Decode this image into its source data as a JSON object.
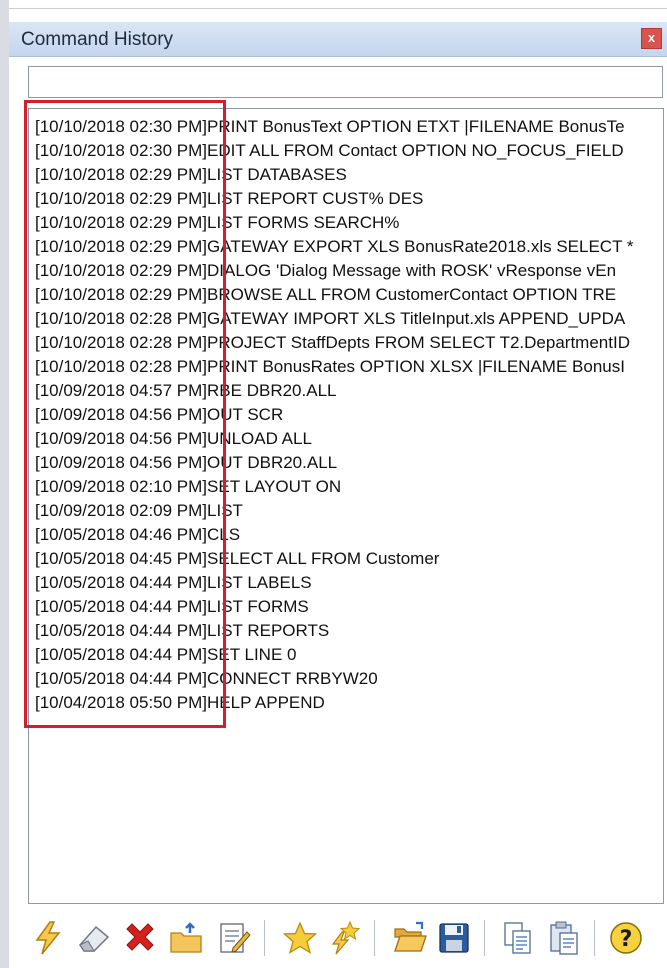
{
  "window": {
    "title": "Command History",
    "close_label": "x"
  },
  "command_input": {
    "value": "",
    "placeholder": ""
  },
  "history": [
    {
      "timestamp": "[10/10/2018 02:30 PM]",
      "command": "PRINT BonusText OPTION ETXT |FILENAME BonusTe"
    },
    {
      "timestamp": "[10/10/2018 02:30 PM]",
      "command": "EDIT ALL FROM Contact OPTION NO_FOCUS_FIELD"
    },
    {
      "timestamp": "[10/10/2018 02:29 PM]",
      "command": "LIST DATABASES"
    },
    {
      "timestamp": "[10/10/2018 02:29 PM]",
      "command": "LIST REPORT CUST% DES"
    },
    {
      "timestamp": "[10/10/2018 02:29 PM]",
      "command": "LIST FORMS SEARCH%"
    },
    {
      "timestamp": "[10/10/2018 02:29 PM]",
      "command": "GATEWAY EXPORT XLS BonusRate2018.xls SELECT *"
    },
    {
      "timestamp": "[10/10/2018 02:29 PM]",
      "command": "DIALOG 'Dialog Message with ROSK' vResponse vEn"
    },
    {
      "timestamp": "[10/10/2018 02:29 PM]",
      "command": "BROWSE ALL FROM CustomerContact OPTION TRE"
    },
    {
      "timestamp": "[10/10/2018 02:28 PM]",
      "command": "GATEWAY IMPORT XLS TitleInput.xls APPEND_UPDA"
    },
    {
      "timestamp": "[10/10/2018 02:28 PM]",
      "command": "PROJECT StaffDepts FROM SELECT T2.DepartmentID"
    },
    {
      "timestamp": "[10/10/2018 02:28 PM]",
      "command": "PRINT BonusRates OPTION XLSX |FILENAME BonusI"
    },
    {
      "timestamp": "[10/09/2018 04:57 PM]",
      "command": "RBE DBR20.ALL"
    },
    {
      "timestamp": "[10/09/2018 04:56 PM]",
      "command": "OUT SCR"
    },
    {
      "timestamp": "[10/09/2018 04:56 PM]",
      "command": "UNLOAD ALL"
    },
    {
      "timestamp": "[10/09/2018 04:56 PM]",
      "command": "OUT DBR20.ALL"
    },
    {
      "timestamp": "[10/09/2018 02:10 PM]",
      "command": "SET LAYOUT ON"
    },
    {
      "timestamp": "[10/09/2018 02:09 PM]",
      "command": "LIST"
    },
    {
      "timestamp": "[10/05/2018 04:46 PM]",
      "command": "CLS"
    },
    {
      "timestamp": "[10/05/2018 04:45 PM]",
      "command": "SELECT ALL FROM Customer"
    },
    {
      "timestamp": "[10/05/2018 04:44 PM]",
      "command": "LIST LABELS"
    },
    {
      "timestamp": "[10/05/2018 04:44 PM]",
      "command": "LIST FORMS"
    },
    {
      "timestamp": "[10/05/2018 04:44 PM]",
      "command": "LIST REPORTS"
    },
    {
      "timestamp": "[10/05/2018 04:44 PM]",
      "command": "SET LINE 0"
    },
    {
      "timestamp": "[10/05/2018 04:44 PM]",
      "command": "CONNECT RRBYW20"
    },
    {
      "timestamp": "[10/04/2018 05:50 PM]",
      "command": "HELP APPEND"
    }
  ],
  "toolbar": [
    {
      "name": "execute-button",
      "icon": "lightning-icon"
    },
    {
      "name": "erase-button",
      "icon": "eraser-icon"
    },
    {
      "name": "delete-button",
      "icon": "red-x-icon"
    },
    {
      "name": "export-button",
      "icon": "folder-arrow-icon"
    },
    {
      "name": "edit-button",
      "icon": "edit-document-icon"
    },
    {
      "name": "favorite-button",
      "icon": "star-icon"
    },
    {
      "name": "add-favorite-button",
      "icon": "star-lightning-icon"
    },
    {
      "name": "open-button",
      "icon": "open-folder-icon"
    },
    {
      "name": "save-button",
      "icon": "floppy-disk-icon"
    },
    {
      "name": "copy-button",
      "icon": "copy-icon"
    },
    {
      "name": "paste-button",
      "icon": "paste-icon"
    },
    {
      "name": "help-button",
      "icon": "help-icon"
    }
  ],
  "colors": {
    "highlight_border": "#d21f2c",
    "titlebar": "#c4d5ee",
    "close_button": "#d9534f"
  }
}
